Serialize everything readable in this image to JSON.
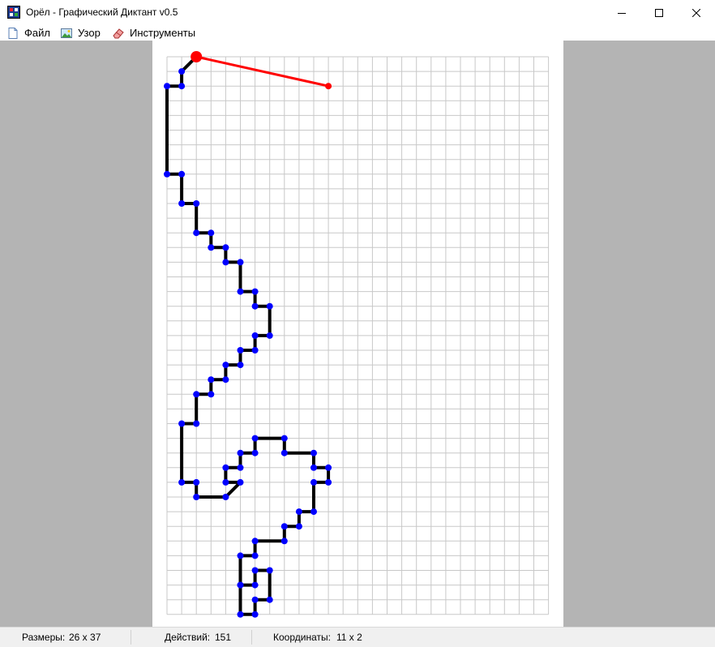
{
  "window": {
    "title": "Орёл - Графический Диктант v0.5",
    "controls": [
      "minimize",
      "maximize",
      "close"
    ]
  },
  "menu": [
    {
      "label": "Файл",
      "icon": "file-icon"
    },
    {
      "label": "Узор",
      "icon": "picture-icon"
    },
    {
      "label": "Инструменты",
      "icon": "eraser-icon"
    }
  ],
  "canvas": {
    "grid_cols": 26,
    "grid_rows": 37,
    "line_color": "#000000",
    "point_color": "#0000ff",
    "cursor_color": "#ff0000",
    "polyline": [
      [
        2,
        0
      ],
      [
        1,
        1
      ],
      [
        1,
        2
      ],
      [
        0,
        2
      ],
      [
        0,
        8
      ],
      [
        1,
        8
      ],
      [
        1,
        10
      ],
      [
        2,
        10
      ],
      [
        2,
        12
      ],
      [
        3,
        12
      ],
      [
        3,
        13
      ],
      [
        4,
        13
      ],
      [
        4,
        14
      ],
      [
        5,
        14
      ],
      [
        5,
        16
      ],
      [
        6,
        16
      ],
      [
        6,
        17
      ],
      [
        7,
        17
      ],
      [
        7,
        19
      ],
      [
        6,
        19
      ],
      [
        6,
        20
      ],
      [
        5,
        20
      ],
      [
        5,
        21
      ],
      [
        4,
        21
      ],
      [
        4,
        22
      ],
      [
        3,
        22
      ],
      [
        3,
        23
      ],
      [
        2,
        23
      ],
      [
        2,
        25
      ],
      [
        1,
        25
      ],
      [
        1,
        29
      ],
      [
        2,
        29
      ],
      [
        2,
        30
      ],
      [
        4,
        30
      ],
      [
        5,
        29
      ],
      [
        4,
        29
      ],
      [
        4,
        28
      ],
      [
        5,
        28
      ],
      [
        5,
        27
      ],
      [
        6,
        27
      ],
      [
        6,
        26
      ],
      [
        8,
        26
      ],
      [
        8,
        27
      ],
      [
        10,
        27
      ],
      [
        10,
        28
      ],
      [
        11,
        28
      ],
      [
        11,
        29
      ],
      [
        10,
        29
      ],
      [
        10,
        31
      ],
      [
        9,
        31
      ],
      [
        9,
        32
      ],
      [
        8,
        32
      ],
      [
        8,
        33
      ],
      [
        6,
        33
      ],
      [
        6,
        34
      ],
      [
        5,
        34
      ],
      [
        5,
        36
      ],
      [
        6,
        36
      ],
      [
        6,
        35
      ],
      [
        7,
        35
      ],
      [
        7,
        37
      ],
      [
        6,
        37
      ],
      [
        6,
        38
      ],
      [
        5,
        38
      ],
      [
        5,
        36
      ]
    ],
    "polyline2": [
      [
        10,
        28
      ],
      [
        11,
        29
      ]
    ],
    "cursor_from": [
      2,
      0
    ],
    "cursor_to": [
      11,
      2
    ]
  },
  "status": {
    "size_label": "Размеры:",
    "size_value": "26 x 37",
    "actions_label": "Действий:",
    "actions_value": "151",
    "coords_label": "Координаты:",
    "coords_value": "11 x 2"
  }
}
